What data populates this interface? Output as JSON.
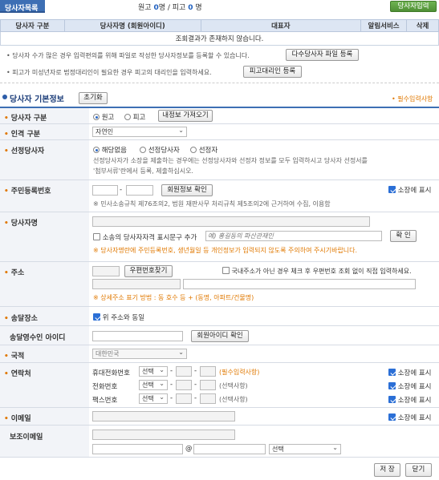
{
  "header": {
    "tab_title": "당사자목록",
    "plaintiff_label": "원고",
    "plaintiff_count": "0",
    "plaintiff_unit": "명 / ",
    "defendant_label": "피고",
    "defendant_count": "0",
    "defendant_unit": "명",
    "add_button": "당사자입력"
  },
  "list": {
    "columns": [
      "당사자 구분",
      "당사자명 (회원아이디)",
      "대표자",
      "알림서비스",
      "삭제"
    ],
    "empty_message": "조회결과가 존재하지 않습니다."
  },
  "notes": {
    "multi_note": "• 당사자 수가 많은 경우 입력편의를 위해 파일로 작성한 당사자정보를 등록할 수 있습니다.",
    "multi_button": "다수당사자 파일 등록",
    "proxy_note": "• 피고가 미성년자로 법정대리인이 필요한 경우 피고의 대리인을 입력하세요.",
    "proxy_button": "피고대리인 등록"
  },
  "section": {
    "title": "당사자 기본정보",
    "reset_button": "초기화",
    "required_note": "• 필수입력사항"
  },
  "form": {
    "party_type": {
      "label": "당사자 구분",
      "opt1": "원고",
      "opt2": "피고",
      "load_button": "내정보 가져오기"
    },
    "person_type": {
      "label": "인격 구분",
      "value": "자연인"
    },
    "appointed": {
      "label": "선정당사자",
      "opt1": "해당없음",
      "opt2": "선정당사자",
      "opt3": "선정자",
      "desc1": "선정당사자가 소장을 제출하는 경우에는 선정당사자와 선정자 정보를 모두 입력하시고 당사자 선정서를",
      "desc2": "'첨부서류'란에서 등록, 제출하십시오."
    },
    "rrn": {
      "label": "주민등록번호",
      "member_button": "회원정보 확인",
      "show_on_complaint": "소장에 표시",
      "note": "※ 민사소송규칙 제76조의2, 법원 재판사무 처리규칙 제5조의2에 근거하여 수집, 이용함"
    },
    "name": {
      "label": "당사자명",
      "qualifier_check": "소송의 당사자자격 표시문구 추가",
      "qualifier_placeholder": "예) 홍길동의 파산관재인",
      "confirm_button": "확 인",
      "warning": "※ 당사자명란에 주민등록번호, 생년월일 등 개인정보가 입력되지 않도록 주의하여 주시기바랍니다."
    },
    "address": {
      "label": "주소",
      "postcode_button": "우편번호찾기",
      "foreign_check": "국내주소가 아닌 경우 체크 후 우편번호 조회 없이 직접 입력하세요.",
      "note_prefix": "※ 상세주소 표기 방법 : ",
      "note_detail": "동 호수 등 + (동명, 아파트/건물명)"
    },
    "service_place": {
      "label": "송달장소",
      "same_check": "위 주소와 동일"
    },
    "receiver_id": {
      "label": "송달영수인 아이디",
      "member_button": "회원아이디 확인"
    },
    "nationality": {
      "label": "국적",
      "value": "대한민국"
    },
    "contact": {
      "label": "연락처",
      "mobile_label": "휴대전화번호",
      "mobile_note": "(필수입력사항)",
      "phone_label": "전화번호",
      "phone_note": "(선택사항)",
      "fax_label": "팩스번호",
      "fax_note": "(선택사항)",
      "select_text": "선택",
      "dash": "-",
      "show_on_complaint": "소장에 표시"
    },
    "email": {
      "label": "이메일",
      "show_on_complaint": "소장에 표시"
    },
    "sub_email": {
      "label": "보조이메일",
      "at": "@",
      "select_text": "선택"
    }
  },
  "footer": {
    "save_button": "저 장",
    "close_button": "닫기"
  },
  "colors": {
    "accent_blue": "#3d6fb4",
    "required_orange": "#e07800",
    "header_green": "#5a9a3e"
  }
}
